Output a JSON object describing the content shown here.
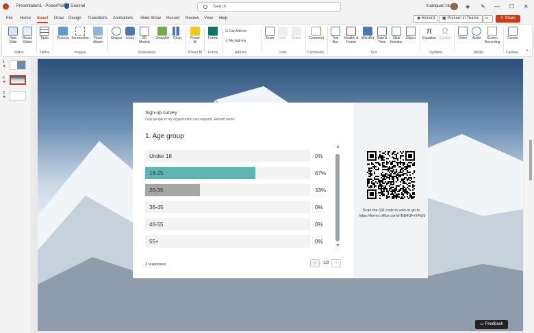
{
  "titlebar": {
    "doc_name": "Presentation1 - PowerPoint",
    "sensitivity": "General",
    "search_placeholder": "Search",
    "user_name": "Yuanquan Hu",
    "minimize": "—",
    "maximize": "☐",
    "close": "✕"
  },
  "menu": {
    "tabs": [
      "File",
      "Home",
      "Insert",
      "Draw",
      "Design",
      "Transitions",
      "Animations",
      "Slide Show",
      "Record",
      "Review",
      "View",
      "Help"
    ],
    "active": "Insert",
    "record_btn": "Record",
    "present_btn": "Present in Teams",
    "share_btn": "Share"
  },
  "ribbon": {
    "buttons": [
      {
        "label": "New Slide",
        "icon": "new-slide-icon"
      },
      {
        "label": "Reuse Slides",
        "icon": "reuse-slides-icon"
      },
      {
        "label": "Table",
        "icon": "table-icon"
      },
      {
        "label": "Pictures",
        "icon": "pictures-icon"
      },
      {
        "label": "Screenshot",
        "icon": "screenshot-icon"
      },
      {
        "label": "Photo Album",
        "icon": "photo-album-icon"
      },
      {
        "label": "Shapes",
        "icon": "shapes-icon"
      },
      {
        "label": "Icons",
        "icon": "icons-icon"
      },
      {
        "label": "3D Models",
        "icon": "3d-models-icon"
      },
      {
        "label": "SmartArt",
        "icon": "smartart-icon"
      },
      {
        "label": "Chart",
        "icon": "chart-icon"
      },
      {
        "label": "Power BI",
        "icon": "power-bi-icon"
      },
      {
        "label": "Forms",
        "icon": "forms-icon"
      },
      {
        "label": "Get Add-ins",
        "icon": "get-addins-icon"
      },
      {
        "label": "My Add-ins",
        "icon": "my-addins-icon"
      },
      {
        "label": "Zoom",
        "icon": "zoom-icon"
      },
      {
        "label": "Link",
        "icon": "link-icon"
      },
      {
        "label": "Action",
        "icon": "action-icon"
      },
      {
        "label": "Comment",
        "icon": "comment-icon"
      },
      {
        "label": "Text Box",
        "icon": "text-box-icon"
      },
      {
        "label": "Header & Footer",
        "icon": "header-footer-icon"
      },
      {
        "label": "WordArt",
        "icon": "wordart-icon"
      },
      {
        "label": "Date & Time",
        "icon": "date-time-icon"
      },
      {
        "label": "Slide Number",
        "icon": "slide-number-icon"
      },
      {
        "label": "Object",
        "icon": "object-icon"
      },
      {
        "label": "Equation",
        "icon": "equation-icon"
      },
      {
        "label": "Symbol",
        "icon": "symbol-icon"
      },
      {
        "label": "Video",
        "icon": "video-icon"
      },
      {
        "label": "Audio",
        "icon": "audio-icon"
      },
      {
        "label": "Screen Recording",
        "icon": "screen-recording-icon"
      },
      {
        "label": "Cameo",
        "icon": "cameo-icon"
      }
    ],
    "groups": [
      "Slides",
      "Tables",
      "Images",
      "Illustrations",
      "Power BI",
      "Forms",
      "Add-ins",
      "Links",
      "Comments",
      "Text",
      "Symbols",
      "Media",
      "Camera"
    ]
  },
  "slides_panel": {
    "slides": [
      {
        "num": "1",
        "mark": "★"
      },
      {
        "num": "2",
        "mark": "★"
      },
      {
        "num": "3",
        "mark": "★"
      }
    ]
  },
  "survey": {
    "title": "Sign-up survey",
    "subtitle": "Only people in my organization can respond. Record name",
    "question": "1. Age group",
    "options": [
      {
        "label": "Under 18",
        "pct": "0%",
        "value": 0
      },
      {
        "label": "18-25",
        "pct": "67%",
        "value": 67
      },
      {
        "label": "26-35",
        "pct": "33%",
        "value": 33
      },
      {
        "label": "36-45",
        "pct": "0%",
        "value": 0
      },
      {
        "label": "46-55",
        "pct": "0%",
        "value": 0
      },
      {
        "label": "55+",
        "pct": "0%",
        "value": 0
      }
    ],
    "responses": "3 responses",
    "page": "1/3",
    "qr_text": "Scan the QR code to vote or go to https://forms.office.com/r/NB4GFxYHU0",
    "colors": {
      "fill_1": "#5fb5b0",
      "fill_2": "#a6a6a6"
    }
  },
  "feedback": "Feedback"
}
